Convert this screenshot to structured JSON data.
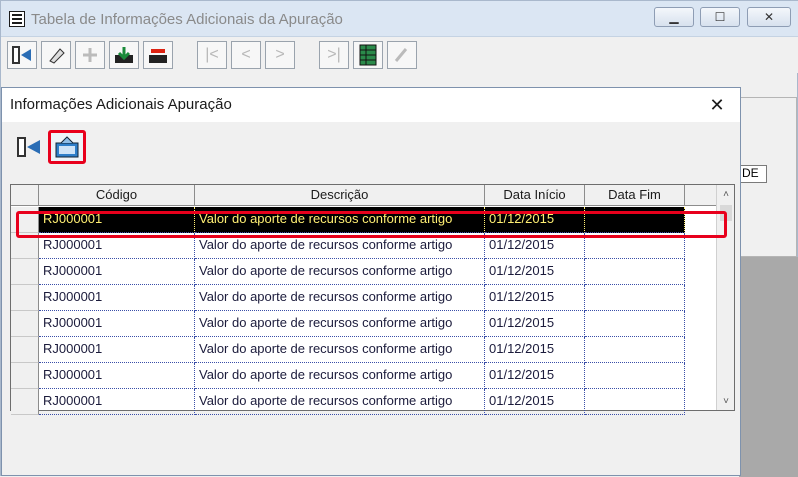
{
  "main_window": {
    "title": "Tabela de Informações Adicionais da Apuração",
    "background_field_text": "DE"
  },
  "dialog": {
    "title": "Informações Adicionais Apuração",
    "close_glyph": "✕"
  },
  "grid": {
    "columns": [
      "Código",
      "Descrição",
      "Data Início",
      "Data Fim"
    ],
    "rows": [
      {
        "codigo": "RJ000001",
        "descricao": "Valor do aporte de recursos conforme artigo",
        "data_inicio": "01/12/2015",
        "data_fim": "",
        "selected": true
      },
      {
        "codigo": "RJ000001",
        "descricao": "Valor do aporte de recursos conforme artigo",
        "data_inicio": "01/12/2015",
        "data_fim": ""
      },
      {
        "codigo": "RJ000001",
        "descricao": "Valor do aporte de recursos conforme artigo",
        "data_inicio": "01/12/2015",
        "data_fim": ""
      },
      {
        "codigo": "RJ000001",
        "descricao": "Valor do aporte de recursos conforme artigo",
        "data_inicio": "01/12/2015",
        "data_fim": ""
      },
      {
        "codigo": "RJ000001",
        "descricao": "Valor do aporte de recursos conforme artigo",
        "data_inicio": "01/12/2015",
        "data_fim": ""
      },
      {
        "codigo": "RJ000001",
        "descricao": "Valor do aporte de recursos conforme artigo",
        "data_inicio": "01/12/2015",
        "data_fim": ""
      },
      {
        "codigo": "RJ000001",
        "descricao": "Valor do aporte de recursos conforme artigo",
        "data_inicio": "01/12/2015",
        "data_fim": ""
      },
      {
        "codigo": "RJ000001",
        "descricao": "Valor do aporte de recursos conforme artigo",
        "data_inicio": "01/12/2015",
        "data_fim": ""
      }
    ]
  },
  "colors": {
    "selection_bg": "#000000",
    "selection_text": "#ffef73",
    "highlight": "#e8001c",
    "grid_text": "#1b1b3b"
  },
  "icons": [
    "exit-door-icon",
    "eraser-icon",
    "add-disabled-icon",
    "save-icon",
    "delete-icon",
    "first-icon",
    "previous-icon",
    "next-icon",
    "last-icon",
    "grid-view-icon",
    "edit-disabled-icon",
    "undo-icon"
  ]
}
